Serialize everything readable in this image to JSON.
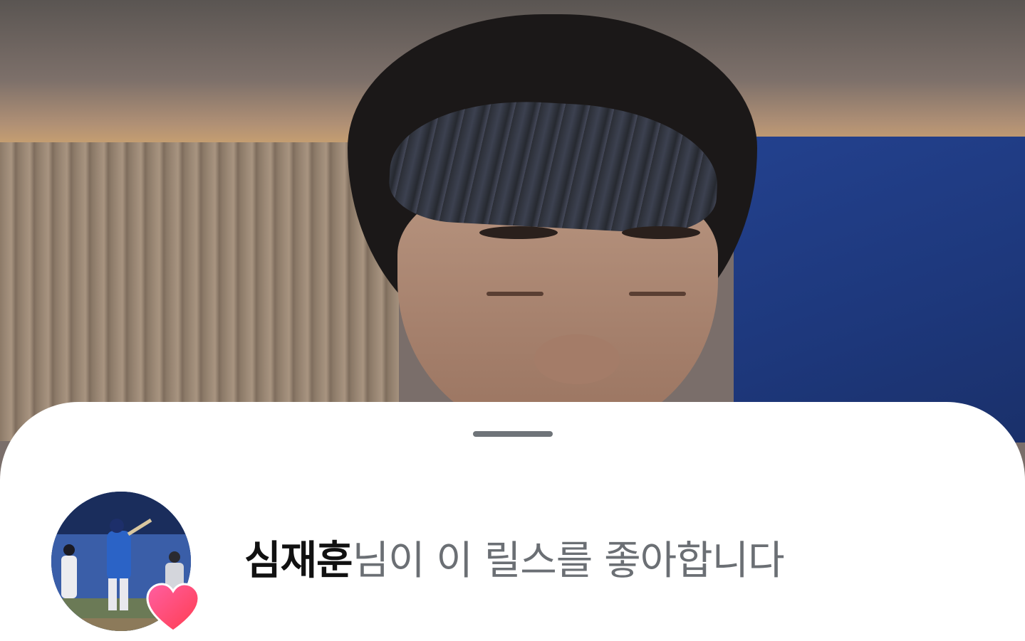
{
  "app": {
    "accent_heart_color": "#ff3d6e"
  },
  "sheet": {
    "username": "심재훈",
    "action_text": "님이 이 릴스를 좋아합니다"
  }
}
